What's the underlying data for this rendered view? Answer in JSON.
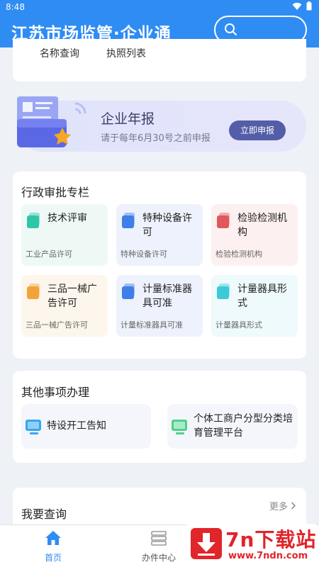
{
  "status": {
    "time": "8:48"
  },
  "app": {
    "title": "江苏市场监管·企业通",
    "search_placeholder": ""
  },
  "top_links": [
    "名称查询",
    "执照列表"
  ],
  "banner": {
    "title": "企业年报",
    "subtitle": "请于每年6月30号之前申报",
    "button": "立即申报"
  },
  "admin": {
    "title": "行政审批专栏",
    "items": [
      {
        "name": "技术评审",
        "desc": "工业产品许可",
        "icon": "teal-doc-icon",
        "bg": "#eef9f6",
        "color": "#2fc6a8"
      },
      {
        "name": "特种设备许可",
        "desc": "特种设备许可",
        "icon": "blue-doc-icon",
        "bg": "#eef2fc",
        "color": "#3f7fe8"
      },
      {
        "name": "检验检测机构",
        "desc": "检验检测机构",
        "icon": "red-doc-icon",
        "bg": "#fdf0f0",
        "color": "#e0575c"
      },
      {
        "name": "三品一械广告许可",
        "desc": "三品一械广告许可",
        "icon": "orange-doc-icon",
        "bg": "#fdf6ec",
        "color": "#f2a43a"
      },
      {
        "name": "计量标准器具可准",
        "desc": "计量标准器具可准",
        "icon": "blue-doc-icon",
        "bg": "#eef2fc",
        "color": "#3f7fe8"
      },
      {
        "name": "计量器具形式",
        "desc": "计量器具形式",
        "icon": "cyan-doc-icon",
        "bg": "#eefafb",
        "color": "#3cc9d8"
      }
    ]
  },
  "other": {
    "title": "其他事项办理",
    "items": [
      {
        "name": "特设开工告知",
        "icon": "blue-monitor-icon"
      },
      {
        "name": "个体工商户分型分类培育管理平台",
        "icon": "green-monitor-icon"
      }
    ]
  },
  "query": {
    "title": "我要查询",
    "more": "更多"
  },
  "tabs": [
    {
      "label": "首页",
      "active": true,
      "icon": "home-icon"
    },
    {
      "label": "办件中心",
      "active": false,
      "icon": "list-icon"
    }
  ],
  "watermark": {
    "brand": "7n下载站",
    "url": "www.7ndn.com"
  },
  "colors": {
    "primary": "#2f8cf3",
    "banner_button": "#545da7",
    "watermark": "#e0252b"
  }
}
